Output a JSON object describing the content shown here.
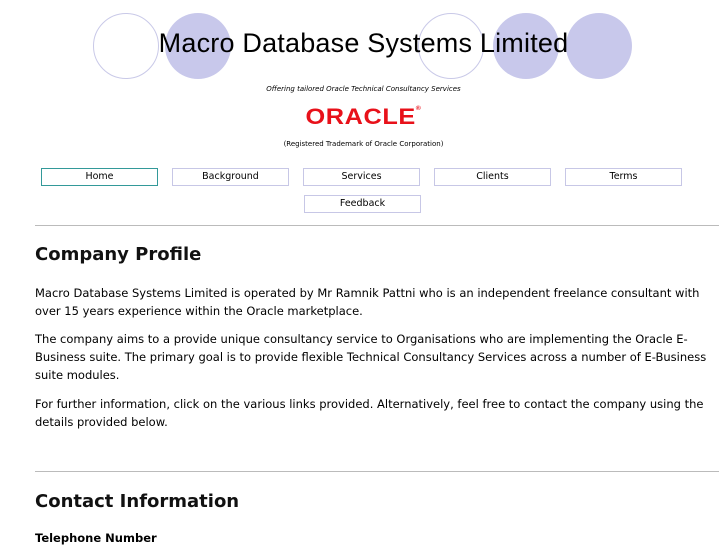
{
  "header": {
    "title": "Macro Database Systems Limited",
    "tagline": "Offering tailored Oracle Technical Consultancy Services",
    "logo_text": "ORACLE",
    "logo_reg": "®",
    "trademark": "(Registered Trademark of Oracle Corporation)"
  },
  "nav": {
    "home": "Home",
    "background": "Background",
    "services": "Services",
    "clients": "Clients",
    "terms": "Terms",
    "feedback": "Feedback"
  },
  "profile": {
    "heading": "Company Profile",
    "p1": "Macro Database Systems Limited is operated by Mr Ramnik Pattni who is an independent freelance consultant with over 15 years experience within the Oracle marketplace.",
    "p2": "The company aims to a provide unique consultancy service to Organisations who are implementing the Oracle E-Business suite.   The primary goal is to provide flexible Technical Consultancy Services across a number of E-Business suite modules.",
    "p3": "For further information, click on the various links provided.  Alternatively, feel free to contact the company using the details provided below."
  },
  "contact": {
    "heading": "Contact Information",
    "telephone_label": "Telephone Number"
  },
  "colors": {
    "circle_fill": "#c8c8eb",
    "oracle_red": "#e8111a",
    "active_border": "#339999"
  }
}
